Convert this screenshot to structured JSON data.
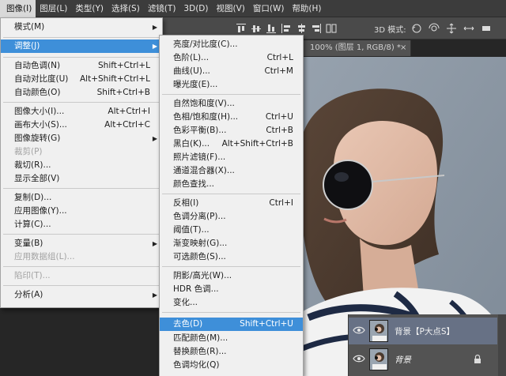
{
  "menubar": {
    "items": [
      "图像(I)",
      "图层(L)",
      "类型(Y)",
      "选择(S)",
      "滤镜(T)",
      "3D(D)",
      "视图(V)",
      "窗口(W)",
      "帮助(H)"
    ],
    "active_index": 0
  },
  "options_bar": {
    "mode_label": "3D 模式:"
  },
  "document_tab": {
    "title": "100% (图层 1, RGB/8) *",
    "close": "×"
  },
  "image_menu": {
    "items": [
      {
        "label": "模式(M)",
        "submenu": true
      },
      {
        "label": "调整(J)",
        "submenu": true,
        "highlighted": true
      },
      {
        "label": "自动色调(N)",
        "shortcut": "Shift+Ctrl+L"
      },
      {
        "label": "自动对比度(U)",
        "shortcut": "Alt+Shift+Ctrl+L"
      },
      {
        "label": "自动颜色(O)",
        "shortcut": "Shift+Ctrl+B"
      },
      {
        "label": "图像大小(I)...",
        "shortcut": "Alt+Ctrl+I"
      },
      {
        "label": "画布大小(S)...",
        "shortcut": "Alt+Ctrl+C"
      },
      {
        "label": "图像旋转(G)",
        "submenu": true
      },
      {
        "label": "裁剪(P)",
        "disabled": true
      },
      {
        "label": "裁切(R)..."
      },
      {
        "label": "显示全部(V)"
      },
      {
        "label": "复制(D)..."
      },
      {
        "label": "应用图像(Y)..."
      },
      {
        "label": "计算(C)..."
      },
      {
        "label": "变量(B)",
        "submenu": true
      },
      {
        "label": "应用数据组(L)...",
        "disabled": true
      },
      {
        "label": "陷印(T)...",
        "disabled": true
      },
      {
        "label": "分析(A)",
        "submenu": true
      }
    ]
  },
  "adjust_menu": {
    "items": [
      {
        "label": "亮度/对比度(C)..."
      },
      {
        "label": "色阶(L)...",
        "shortcut": "Ctrl+L"
      },
      {
        "label": "曲线(U)...",
        "shortcut": "Ctrl+M"
      },
      {
        "label": "曝光度(E)..."
      },
      {
        "label": "自然饱和度(V)..."
      },
      {
        "label": "色相/饱和度(H)...",
        "shortcut": "Ctrl+U"
      },
      {
        "label": "色彩平衡(B)...",
        "shortcut": "Ctrl+B"
      },
      {
        "label": "黑白(K)...",
        "shortcut": "Alt+Shift+Ctrl+B"
      },
      {
        "label": "照片滤镜(F)..."
      },
      {
        "label": "通道混合器(X)..."
      },
      {
        "label": "颜色查找..."
      },
      {
        "label": "反相(I)",
        "shortcut": "Ctrl+I"
      },
      {
        "label": "色调分离(P)..."
      },
      {
        "label": "阈值(T)..."
      },
      {
        "label": "渐变映射(G)..."
      },
      {
        "label": "可选颜色(S)..."
      },
      {
        "label": "阴影/高光(W)..."
      },
      {
        "label": "HDR 色调..."
      },
      {
        "label": "变化..."
      },
      {
        "label": "去色(D)",
        "shortcut": "Shift+Ctrl+U",
        "highlighted": true
      },
      {
        "label": "匹配颜色(M)..."
      },
      {
        "label": "替换颜色(R)..."
      },
      {
        "label": "色调均化(Q)"
      }
    ]
  },
  "layers_panel": {
    "layers": [
      {
        "name": "背景【P大点S】",
        "selected": true,
        "italic": false,
        "locked": false
      },
      {
        "name": "背景",
        "selected": false,
        "italic": true,
        "locked": true
      }
    ]
  },
  "colors": {
    "highlight": "#3e8fd9",
    "menu_bg": "#f0f0f0",
    "menubar_bg": "#3c3c3c",
    "layer_selected": "#677185"
  }
}
